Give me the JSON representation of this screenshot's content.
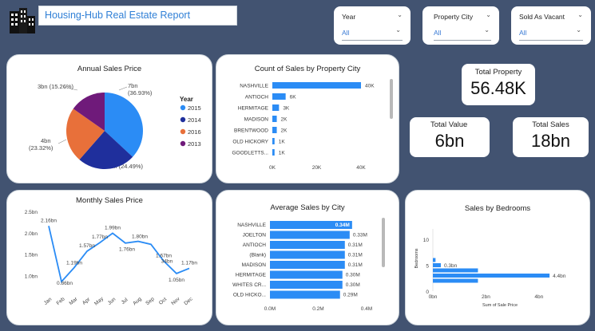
{
  "header": {
    "title": "Housing-Hub Real Estate Report"
  },
  "slicers": [
    {
      "label": "Year",
      "value": "All"
    },
    {
      "label": "Property City",
      "value": "All"
    },
    {
      "label": "Sold As Vacant",
      "value": "All"
    }
  ],
  "kpis": {
    "total_property": {
      "label": "Total Property",
      "value": "56.48K"
    },
    "total_value": {
      "label": "Total Value",
      "value": "6bn"
    },
    "total_sales": {
      "label": "Total Sales",
      "value": "18bn"
    }
  },
  "colors": {
    "c2015": "#2b8cf5",
    "c2014": "#1f2f9c",
    "c2016": "#e8703a",
    "c2013": "#6f1a7a",
    "bar": "#2b8cf5",
    "line": "#2b8cf5"
  },
  "chart_data": [
    {
      "type": "pie",
      "title": "Annual Sales Price",
      "legend_title": "Year",
      "legend_position": "right",
      "slices": [
        {
          "name": "2015",
          "value": 7,
          "label": "7bn",
          "pct": "(36.93%)",
          "share": 36.93
        },
        {
          "name": "2014",
          "value": 4,
          "label": "4bn (24.49%)",
          "share": 24.49
        },
        {
          "name": "2016",
          "value": 4,
          "label": "4bn",
          "pct": "(23.32%)",
          "share": 23.32
        },
        {
          "name": "2013",
          "value": 3,
          "label": "3bn (15.26%)",
          "share": 15.26
        }
      ]
    },
    {
      "type": "bar",
      "title": "Count of Sales by Property City",
      "categories": [
        "NASHVILLE",
        "ANTIOCH",
        "HERMITAGE",
        "MADISON",
        "BRENTWOOD",
        "OLD HICKORY",
        "GOODLETTS..."
      ],
      "values": [
        40000,
        6000,
        3000,
        2000,
        2000,
        1000,
        1000
      ],
      "data_labels": [
        "40K",
        "6K",
        "3K",
        "2K",
        "2K",
        "1K",
        "1K"
      ],
      "x_ticks": [
        "0K",
        "20K",
        "40K"
      ],
      "xlim": [
        0,
        50000
      ]
    },
    {
      "type": "line",
      "title": "Monthly Sales Price",
      "categories": [
        "Jan",
        "Feb",
        "Mar",
        "Apr",
        "May",
        "Jun",
        "Jul",
        "Aug",
        "Sep",
        "Oct",
        "Nov",
        "Dec"
      ],
      "values": [
        2.16,
        0.86,
        1.19,
        1.57,
        1.77,
        1.99,
        1.76,
        1.8,
        1.73,
        1.34,
        1.05,
        1.17
      ],
      "data_labels": [
        "2.16bn",
        "0.86bn",
        "1.19bn",
        "1.57bn",
        "1.77bn",
        "1.99bn",
        "1.76bn",
        "1.80bn",
        "",
        "1.67bn",
        "1.05bn",
        "1.17bn"
      ],
      "extra_labels": [
        "34bn"
      ],
      "y_ticks": [
        "2.5bn",
        "2.0bn",
        "1.5bn",
        "1.0bn"
      ],
      "ylim": [
        0.75,
        2.5
      ]
    },
    {
      "type": "bar",
      "title": "Average Sales by City",
      "categories": [
        "NASHVILLE",
        "JOELTON",
        "ANTIOCH",
        "(Blank)",
        "MADISON",
        "HERMITAGE",
        "WHITES CR...",
        "OLD HICKO..."
      ],
      "values": [
        0.34,
        0.33,
        0.31,
        0.31,
        0.31,
        0.3,
        0.3,
        0.29
      ],
      "data_labels": [
        "0.34M",
        "0.33M",
        "0.31M",
        "0.31M",
        "0.31M",
        "0.30M",
        "0.30M",
        "0.29M"
      ],
      "x_ticks": [
        "0.0M",
        "0.2M",
        "0.4M"
      ],
      "xlim": [
        0,
        0.4
      ]
    },
    {
      "type": "bar",
      "title": "Sales by Bedrooms",
      "xlabel": "Sum of Sale Price",
      "ylabel": "Bedrooms",
      "y_ticks": [
        "10",
        "5",
        "0"
      ],
      "x_ticks": [
        "0bn",
        "2bn",
        "4bn"
      ],
      "bars": [
        {
          "bedrooms": 6,
          "value": 0.1,
          "label": ""
        },
        {
          "bedrooms": 5,
          "value": 0.3,
          "label": "0.3bn"
        },
        {
          "bedrooms": 4,
          "value": 1.7,
          "label": ""
        },
        {
          "bedrooms": 3,
          "value": 4.4,
          "label": "4.4bn"
        },
        {
          "bedrooms": 2,
          "value": 1.7,
          "label": ""
        }
      ],
      "xlim": [
        0,
        5
      ]
    }
  ]
}
